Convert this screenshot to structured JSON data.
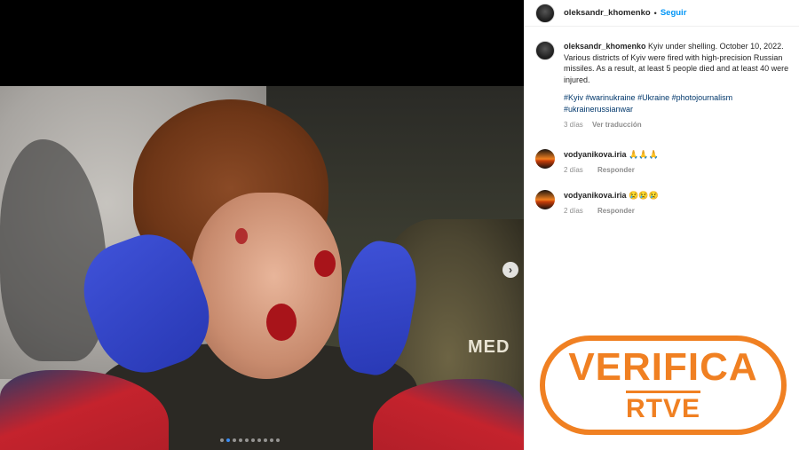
{
  "post": {
    "username": "oleksandr_khomenko",
    "separator": "•",
    "follow_label": "Seguir",
    "caption_text": "Kyiv under shelling. October 10, 2022. Various districts of Kyiv were fired with high-precision Russian missiles. As a result, at least 5 people died and at least 40 were injured.",
    "hashtags": [
      "#Kyiv",
      "#warinukraine",
      "#Ukraine",
      "#photojournalism",
      "#ukrainerussianwar"
    ],
    "caption_age": "3 días",
    "translate_label": "Ver traducción"
  },
  "media": {
    "image_label": "MED",
    "carousel_dots": 10,
    "active_dot": 1,
    "next_icon": "chevron-right-icon"
  },
  "comments": [
    {
      "username": "vodyanikova.iria",
      "text": "🙏🙏🙏",
      "age": "2 días",
      "reply_label": "Responder"
    },
    {
      "username": "vodyanikova.iria",
      "text": "😢😢😢",
      "age": "2 días",
      "reply_label": "Responder"
    }
  ],
  "watermark": {
    "line1": "VERIFICA",
    "line2": "RTVE",
    "color": "#f08022"
  },
  "colors": {
    "link": "#0095f6",
    "hashtag": "#00376b",
    "muted": "#8e8e8e"
  }
}
